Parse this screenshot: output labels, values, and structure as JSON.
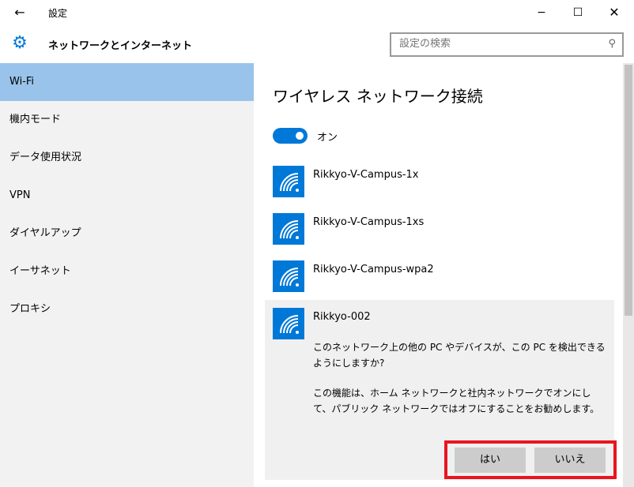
{
  "window": {
    "title": "設定",
    "back_icon": "←",
    "minimize_icon": "−",
    "maximize_icon": "☐",
    "close_icon": "✕"
  },
  "header": {
    "section_title": "ネットワークとインターネット",
    "search_placeholder": "設定の検索",
    "icon": "gear-icon"
  },
  "sidebar": {
    "items": [
      {
        "label": "Wi-Fi",
        "selected": true
      },
      {
        "label": "機内モード",
        "selected": false
      },
      {
        "label": "データ使用状況",
        "selected": false
      },
      {
        "label": "VPN",
        "selected": false
      },
      {
        "label": "ダイヤルアップ",
        "selected": false
      },
      {
        "label": "イーサネット",
        "selected": false
      },
      {
        "label": "プロキシ",
        "selected": false
      }
    ]
  },
  "main": {
    "title": "ワイヤレス ネットワーク接続",
    "toggle": {
      "state": "on",
      "label": "オン"
    },
    "networks": [
      {
        "name": "Rikkyo-V-Campus-1x"
      },
      {
        "name": "Rikkyo-V-Campus-1xs"
      },
      {
        "name": "Rikkyo-V-Campus-wpa2"
      }
    ],
    "expanded_network": {
      "name": "Rikkyo-002",
      "question": "このネットワーク上の他の PC やデバイスが、この PC を検出できるようにしますか?",
      "info": "この機能は、ホーム ネットワークと社内ネットワークでオンにして、パブリック ネットワークではオフにすることをお勧めします。",
      "yes_label": "はい",
      "no_label": "いいえ"
    }
  },
  "colors": {
    "accent": "#0078d7",
    "sidebar_bg": "#f2f2f2",
    "selected_bg": "#99c3ea",
    "highlight_box": "#e8151f"
  }
}
